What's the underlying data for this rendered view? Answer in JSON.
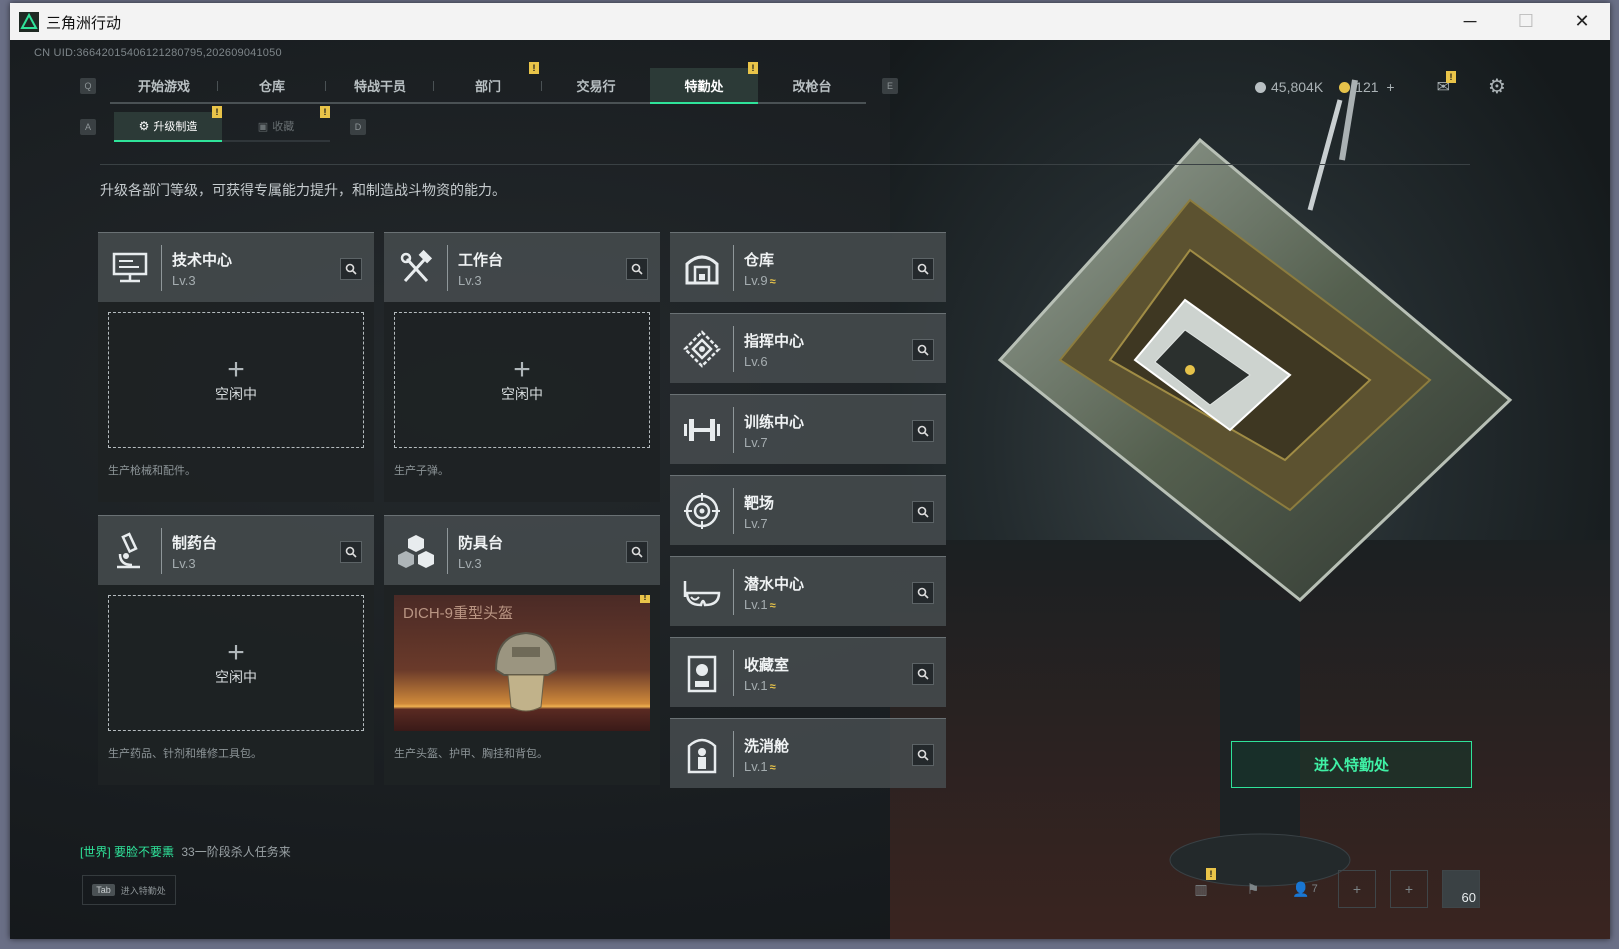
{
  "window": {
    "title": "三角洲行动"
  },
  "uid": "CN UID:3664201540612128079​5,202609041050",
  "nav": {
    "key_left": "Q",
    "key_right": "E",
    "tabs": [
      "开始游戏",
      "仓库",
      "特战干员",
      "部门",
      "交易行",
      "特勤处",
      "改枪台"
    ],
    "active": "特勤处"
  },
  "subnav": {
    "key_left": "A",
    "key_right": "D",
    "tabs": [
      "升级制造",
      "收藏"
    ],
    "active": "升级制造"
  },
  "currency": {
    "silver": "45,804K",
    "gold": "121",
    "plus": "+"
  },
  "description": "升级各部门等级，可获得专属能力提升，和制造战斗物资的能力。",
  "craft_stations": [
    {
      "name": "技术中心",
      "level": "Lv.3",
      "icon": "monitor-icon",
      "status": "空闲中",
      "caption": "生产枪械和配件。"
    },
    {
      "name": "工作台",
      "level": "Lv.3",
      "icon": "hammer-wrench-icon",
      "status": "空闲中",
      "caption": "生产子弹。"
    },
    {
      "name": "制药台",
      "level": "Lv.3",
      "icon": "microscope-icon",
      "status": "空闲中",
      "caption": "生产药品、针剂和维修工具包。"
    },
    {
      "name": "防具台",
      "level": "Lv.3",
      "icon": "cubes-icon",
      "product": "DICH-9重型头盔",
      "caption": "生产头盔、护甲、胸挂和背包。"
    }
  ],
  "departments": [
    {
      "name": "仓库",
      "level": "Lv.9",
      "upgrade": true,
      "icon": "warehouse-icon"
    },
    {
      "name": "指挥中心",
      "level": "Lv.6",
      "upgrade": false,
      "icon": "diamond-target-icon"
    },
    {
      "name": "训练中心",
      "level": "Lv.7",
      "upgrade": false,
      "icon": "dumbbell-icon"
    },
    {
      "name": "靶场",
      "level": "Lv.7",
      "upgrade": false,
      "icon": "crosshair-icon"
    },
    {
      "name": "潜水中心",
      "level": "Lv.1",
      "upgrade": true,
      "icon": "goggles-icon"
    },
    {
      "name": "收藏室",
      "level": "Lv.1",
      "upgrade": true,
      "icon": "display-case-icon"
    },
    {
      "name": "洗消舱",
      "level": "Lv.1",
      "upgrade": true,
      "icon": "decon-pod-icon"
    }
  ],
  "upgrade_glyph": "≈",
  "enter_button": "进入特勤处",
  "chat": {
    "channel": "[世界]",
    "user": "要脸不要熏",
    "message": "33一阶段杀人任务来"
  },
  "tab_hint": {
    "key": "Tab",
    "label": "进入特勤处"
  },
  "bottom": {
    "friends_count": "7",
    "level": "60"
  },
  "colors": {
    "accent": "#2fe39a",
    "badge": "#e9c449",
    "upgrade": "#e6c24a"
  }
}
